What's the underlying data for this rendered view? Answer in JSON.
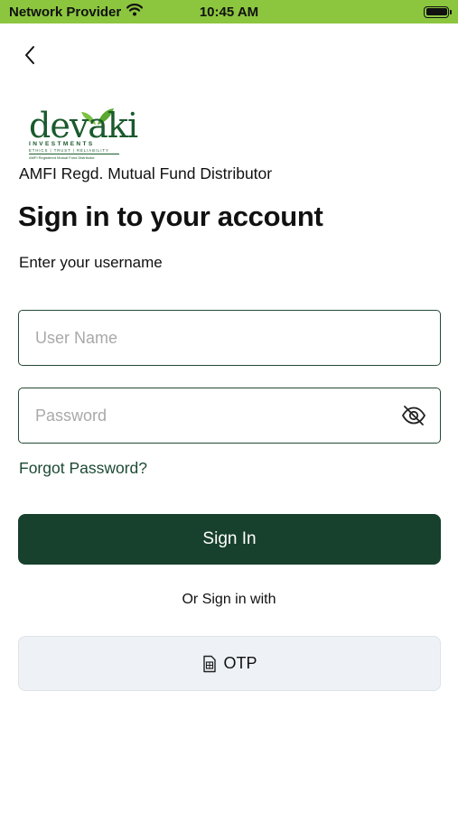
{
  "status_bar": {
    "carrier": "Network Provider",
    "time": "10:45 AM",
    "battery_level": 1.0,
    "icons": [
      "wifi-icon",
      "battery-icon"
    ]
  },
  "header": {
    "back_icon": "chevron-left-icon"
  },
  "logo": {
    "word": "devaki",
    "line1": "INVESTMENTS",
    "line2": "ETHICS | TRUST | RELIABILITY",
    "line3": "AMFI Registered Mutual Fund Distributor"
  },
  "brand": {
    "tagline": "AMFI Regd. Mutual Fund Distributor"
  },
  "form": {
    "title": "Sign in to your account",
    "subtitle": "Enter your username",
    "username": {
      "value": "",
      "placeholder": "User Name"
    },
    "password": {
      "value": "",
      "placeholder": "Password",
      "toggle_icon": "eye-off-icon"
    },
    "forgot_label": "Forgot Password?",
    "submit_label": "Sign In",
    "alt_label": "Or Sign in with",
    "otp_label": "OTP",
    "otp_icon": "sim-card-icon"
  },
  "colors": {
    "status_bar": "#8cc63f",
    "primary": "#17402d",
    "link": "#1d4a33",
    "field_border": "#244a34",
    "otp_bg": "#eef2f6"
  }
}
